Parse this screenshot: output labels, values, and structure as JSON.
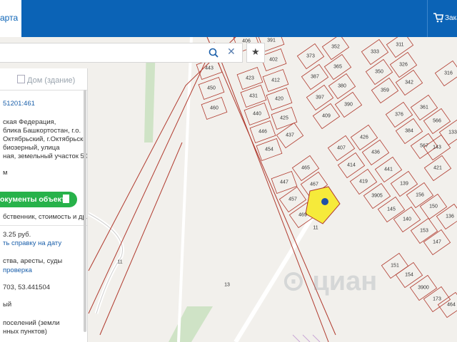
{
  "header": {
    "brand": "арта",
    "order_label": "Зака"
  },
  "search": {
    "value": "",
    "placeholder": ""
  },
  "panel": {
    "tab_building": "Дом (здание)",
    "cad_number": "51201:461",
    "address_lines": [
      "ская Федерация,",
      "блика Башкортостан, г.о.",
      "Октябрьский, г.Октябрьский,",
      "биозерный, улица",
      "ная, земельный участок 50"
    ],
    "category_short": "м",
    "docs_button": "окументы объекта",
    "docs_sub": "бственник, стоимость и др.",
    "price": "3.25 руб.",
    "order_cert_link": "ть справку на дату",
    "restrictions": "ства, аресты, суды",
    "check_link": "проверка",
    "coords": "703, 53.441504",
    "status": "ый",
    "land_category": [
      "поселений (земли",
      "нных пунктов)"
    ]
  },
  "parcel_labels": [
    "443",
    "450",
    "460",
    "406",
    "391",
    "423",
    "402",
    "431",
    "412",
    "440",
    "420",
    "446",
    "425",
    "454",
    "437",
    "373",
    "352",
    "387",
    "365",
    "397",
    "380",
    "409",
    "390",
    "333",
    "311",
    "350",
    "326",
    "359",
    "342",
    "316",
    "376",
    "361",
    "384",
    "566",
    "567",
    "143",
    "133",
    "421",
    "407",
    "426",
    "414",
    "436",
    "419",
    "441",
    "3905",
    "139",
    "156",
    "145",
    "140",
    "150",
    "136",
    "153",
    "147",
    "151",
    "154",
    "3900",
    "173",
    "464",
    "447",
    "465",
    "457",
    "467",
    "469",
    "11",
    "11",
    "13"
  ],
  "colors": {
    "header": "#0b63b6",
    "parcel_border": "#b03a2e",
    "selected_parcel": "#f6ea3a",
    "docs_button": "#27b24a",
    "link": "#1a5faa"
  },
  "icons": [
    "cart-icon",
    "search-icon",
    "close-icon",
    "star-icon",
    "building-icon",
    "document-icon",
    "location-marker-icon"
  ]
}
